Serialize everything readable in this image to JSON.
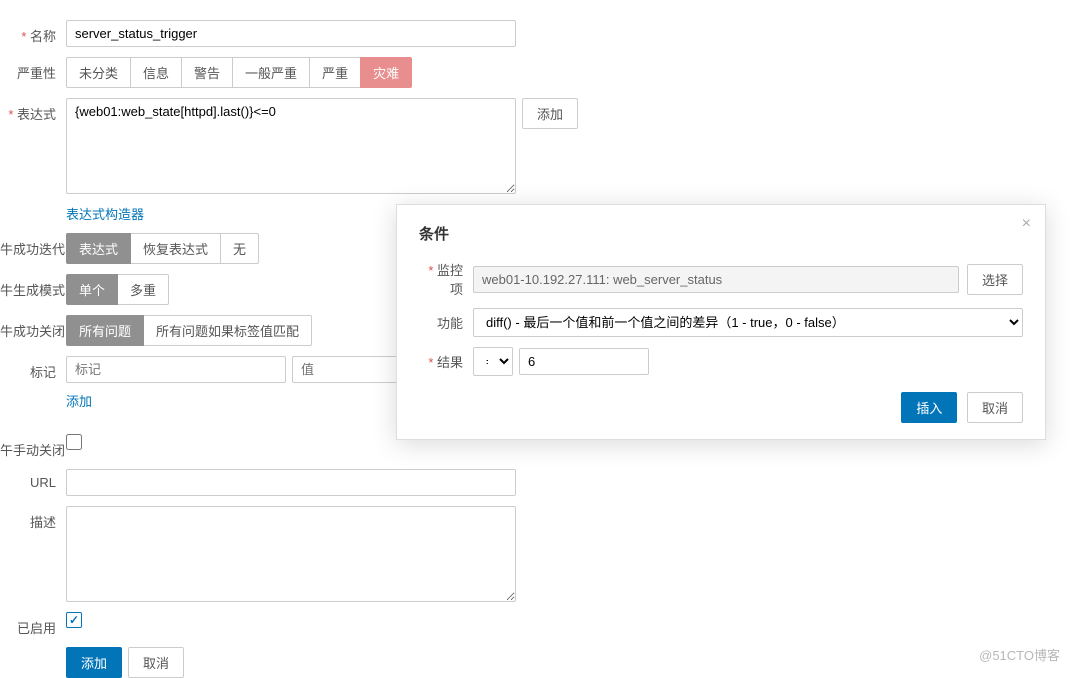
{
  "form": {
    "name_label": "名称",
    "name_value": "server_status_trigger",
    "severity_label": "严重性",
    "severities": [
      "未分类",
      "信息",
      "警告",
      "一般严重",
      "严重",
      "灾难"
    ],
    "expression_label": "表达式",
    "expression_value": "{web01:web_state[httpd].last()}<=0",
    "add_btn": "添加",
    "expr_builder_link": "表达式构造器",
    "ok_gen_label": "牛成功迭代",
    "ok_gen_options": [
      "表达式",
      "恢复表达式",
      "无"
    ],
    "problem_gen_label": "牛生成模式",
    "problem_gen_options": [
      "单个",
      "多重"
    ],
    "ok_close_label": "牛成功关闭",
    "ok_close_options": [
      "所有问题",
      "所有问题如果标签值匹配"
    ],
    "tag_label": "标记",
    "tag_placeholder": "标记",
    "value_placeholder": "值",
    "tag_add_link": "添加",
    "manual_close_label": "午手动关闭",
    "url_label": "URL",
    "desc_label": "描述",
    "enabled_label": "已启用",
    "submit_add": "添加",
    "submit_cancel": "取消"
  },
  "modal": {
    "title": "条件",
    "item_label": "监控项",
    "item_value": "web01-10.192.27.111: web_server_status",
    "select_btn": "选择",
    "func_label": "功能",
    "func_value": "diff() - 最后一个值和前一个值之间的差异（1 - true，0 - false）",
    "result_label": "结果",
    "operator": "=",
    "result_value": "6",
    "insert_btn": "插入",
    "cancel_btn": "取消"
  },
  "watermark": "@51CTO博客"
}
